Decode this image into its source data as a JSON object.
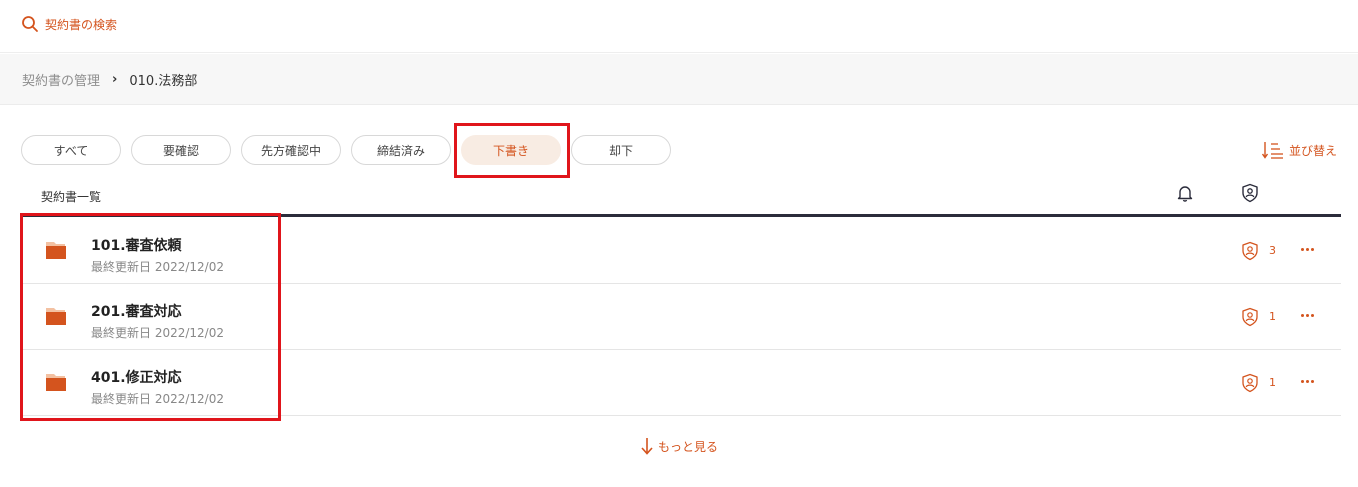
{
  "search": {
    "label": "契約書の検索"
  },
  "breadcrumb": {
    "root": "契約書の管理",
    "separator": "›",
    "current": "010.法務部"
  },
  "filters": [
    {
      "label": "すべて",
      "active": false
    },
    {
      "label": "要確認",
      "active": false
    },
    {
      "label": "先方確認中",
      "active": false
    },
    {
      "label": "締結済み",
      "active": false
    },
    {
      "label": "下書き",
      "active": true
    },
    {
      "label": "却下",
      "active": false
    }
  ],
  "sort": {
    "label": "並び替え",
    "icon": "sort-icon"
  },
  "list": {
    "title": "契約書一覧",
    "header_icons": [
      "bell-icon",
      "shield-user-icon"
    ],
    "rows": [
      {
        "name": "101.審査依頼",
        "updated": "最終更新日 2022/12/02",
        "count": "3"
      },
      {
        "name": "201.審査対応",
        "updated": "最終更新日 2022/12/02",
        "count": "1"
      },
      {
        "name": "401.修正対応",
        "updated": "最終更新日 2022/12/02",
        "count": "1"
      }
    ]
  },
  "more": {
    "label": "もっと見る",
    "icon": "arrow-down-icon"
  },
  "colors": {
    "accent": "#d4541e",
    "active_pill_bg": "#f8ece3",
    "highlight": "#e0151b",
    "header_rule": "#2b2c3b"
  }
}
